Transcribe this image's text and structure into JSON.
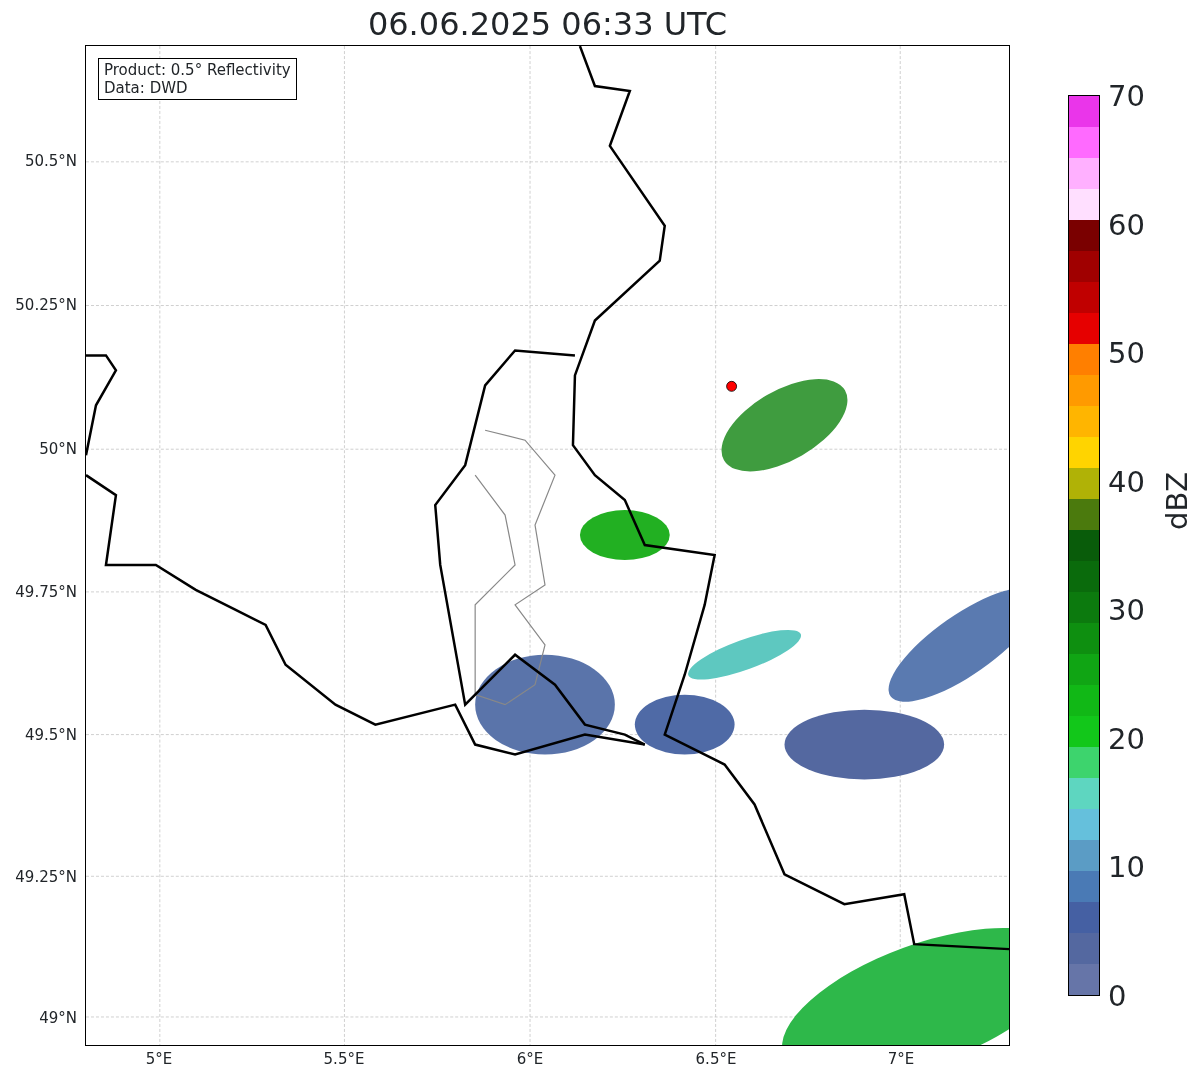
{
  "title": "06.06.2025 06:33 UTC",
  "info_box": [
    "Product: 0.5° Reflectivity",
    "Data: DWD"
  ],
  "y_ticks": [
    "50.5°N",
    "50.25°N",
    "50°N",
    "49.75°N",
    "49.5°N",
    "49.25°N",
    "49°N"
  ],
  "x_ticks": [
    "5°E",
    "5.5°E",
    "6°E",
    "6.5°E",
    "7°E"
  ],
  "colorbar": {
    "label": "dBZ",
    "ticks": [
      "70",
      "60",
      "50",
      "40",
      "30",
      "20",
      "10",
      "0"
    ],
    "segments": [
      {
        "color": "#6675a8"
      },
      {
        "color": "#5468a0"
      },
      {
        "color": "#4560a3"
      },
      {
        "color": "#4a7ab5"
      },
      {
        "color": "#5b9cc5"
      },
      {
        "color": "#65c0dc"
      },
      {
        "color": "#5ed6c0"
      },
      {
        "color": "#3dd46d"
      },
      {
        "color": "#12c71a"
      },
      {
        "color": "#11b816"
      },
      {
        "color": "#10a514"
      },
      {
        "color": "#0e8f10"
      },
      {
        "color": "#0c7a0e"
      },
      {
        "color": "#0a6b0c"
      },
      {
        "color": "#095c0a"
      },
      {
        "color": "#4b7a0d"
      },
      {
        "color": "#b0b206"
      },
      {
        "color": "#ffd400"
      },
      {
        "color": "#ffb500"
      },
      {
        "color": "#ff9a00"
      },
      {
        "color": "#ff7f00"
      },
      {
        "color": "#e60000"
      },
      {
        "color": "#c00000"
      },
      {
        "color": "#a00000"
      },
      {
        "color": "#7a0000"
      },
      {
        "color": "#ffdfff"
      },
      {
        "color": "#ffb0ff"
      },
      {
        "color": "#ff6aff"
      },
      {
        "color": "#ea35ea"
      }
    ]
  }
}
